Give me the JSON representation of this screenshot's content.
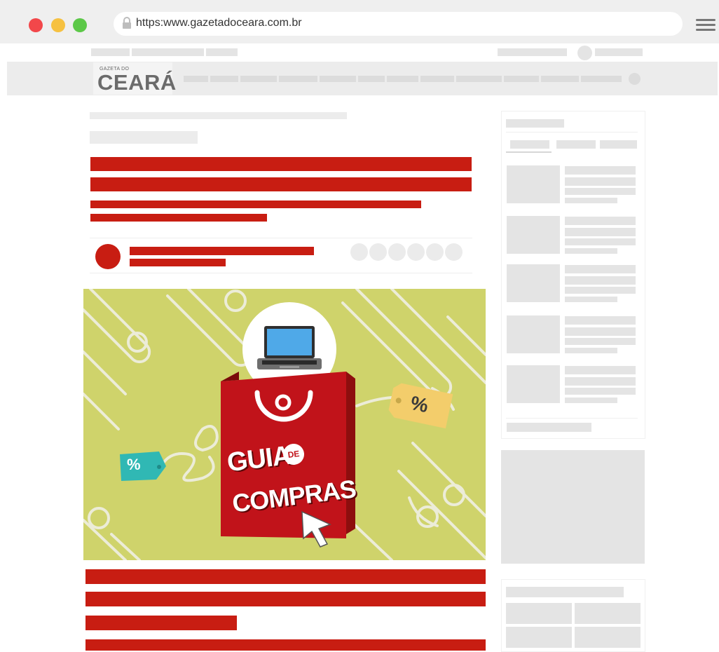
{
  "browser": {
    "url": "https:www.gazetadoceara.com.br",
    "traffic_lights": [
      "#f2474a",
      "#f6c141",
      "#5cc848"
    ]
  },
  "site": {
    "logo_small": "GAZETA DO",
    "logo_big": "CEARÁ"
  },
  "hero": {
    "line1": "GUIA",
    "badge": "DE",
    "line2": "COMPRAS",
    "tag_right": "%",
    "tag_left": "%"
  },
  "colors": {
    "accent_red": "#c81d12",
    "hero_background": "#cfd36b",
    "placeholder_gray": "#e4e4e4"
  }
}
